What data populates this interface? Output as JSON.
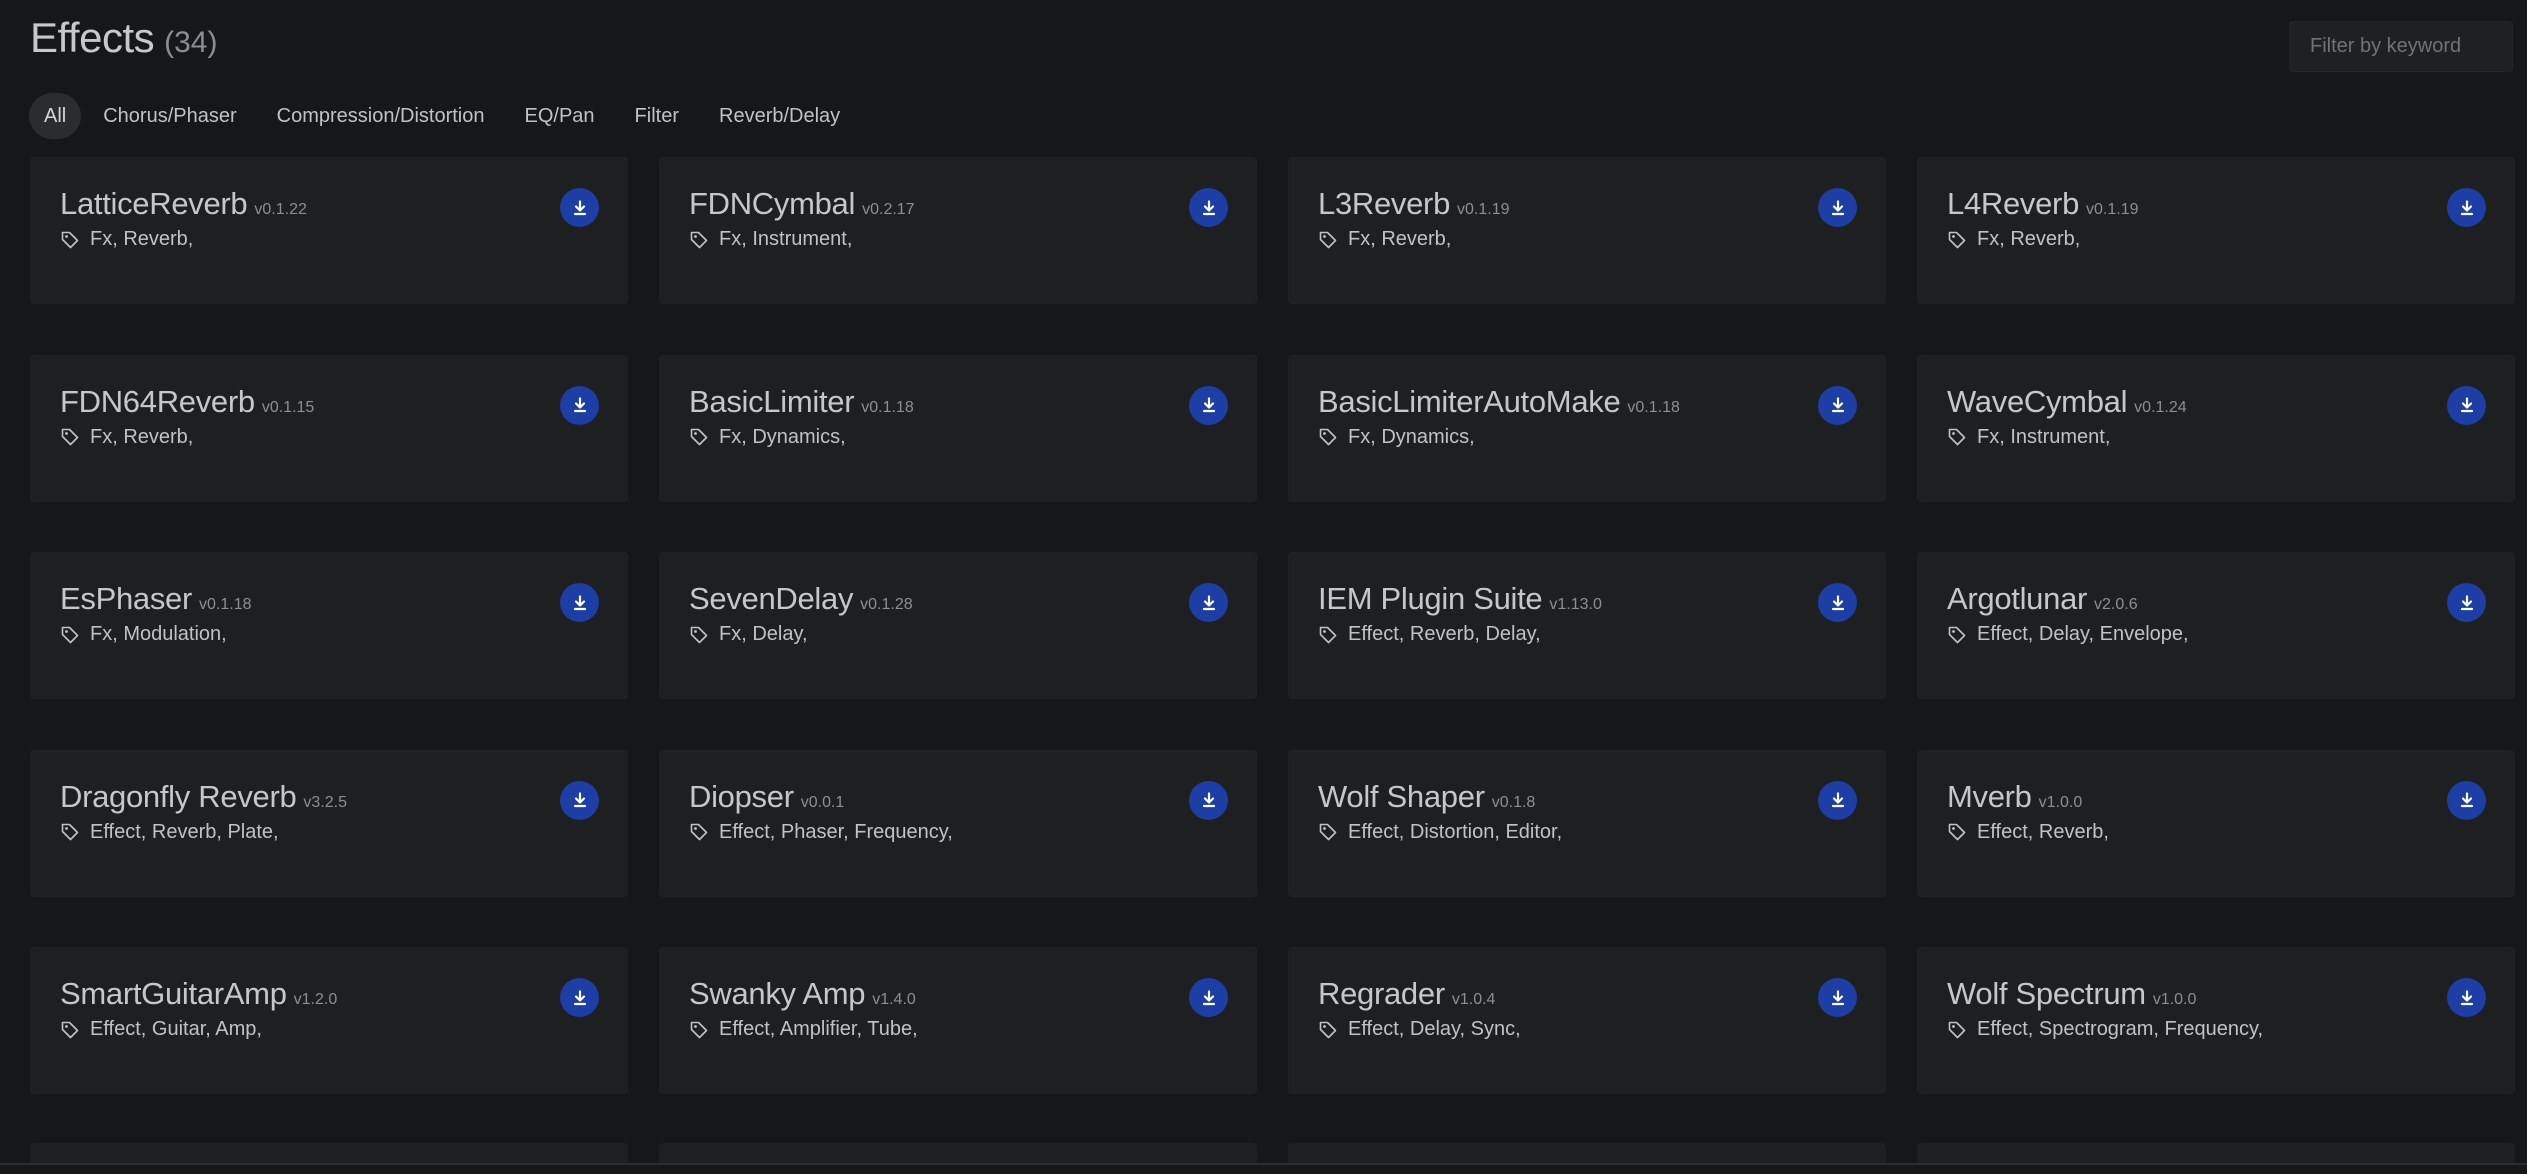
{
  "header": {
    "title": "Effects",
    "count": "(34)"
  },
  "search": {
    "placeholder": "Filter by keyword"
  },
  "tabs": [
    {
      "label": "All",
      "active": true
    },
    {
      "label": "Chorus/Phaser"
    },
    {
      "label": "Compression/Distortion"
    },
    {
      "label": "EQ/Pan"
    },
    {
      "label": "Filter"
    },
    {
      "label": "Reverb/Delay"
    }
  ],
  "colors": {
    "accent": "#1d3ea4",
    "background": "#161718",
    "card": "#1e1f20"
  },
  "icons": {
    "tag": "tag-icon",
    "download": "download-icon"
  },
  "plugins": [
    {
      "name": "LatticeReverb",
      "version": "v0.1.22",
      "tags": "Fx, Reverb,"
    },
    {
      "name": "FDNCymbal",
      "version": "v0.2.17",
      "tags": "Fx, Instrument,"
    },
    {
      "name": "L3Reverb",
      "version": "v0.1.19",
      "tags": "Fx, Reverb,"
    },
    {
      "name": "L4Reverb",
      "version": "v0.1.19",
      "tags": "Fx, Reverb,"
    },
    {
      "name": "FDN64Reverb",
      "version": "v0.1.15",
      "tags": "Fx, Reverb,"
    },
    {
      "name": "BasicLimiter",
      "version": "v0.1.18",
      "tags": "Fx, Dynamics,"
    },
    {
      "name": "BasicLimiterAutoMake",
      "version": "v0.1.18",
      "tags": "Fx, Dynamics,"
    },
    {
      "name": "WaveCymbal",
      "version": "v0.1.24",
      "tags": "Fx, Instrument,"
    },
    {
      "name": "EsPhaser",
      "version": "v0.1.18",
      "tags": "Fx, Modulation,"
    },
    {
      "name": "SevenDelay",
      "version": "v0.1.28",
      "tags": "Fx, Delay,"
    },
    {
      "name": "IEM Plugin Suite",
      "version": "v1.13.0",
      "tags": "Effect, Reverb, Delay,"
    },
    {
      "name": "Argotlunar",
      "version": "v2.0.6",
      "tags": "Effect, Delay, Envelope,"
    },
    {
      "name": "Dragonfly Reverb",
      "version": "v3.2.5",
      "tags": "Effect, Reverb, Plate,"
    },
    {
      "name": "Diopser",
      "version": "v0.0.1",
      "tags": "Effect, Phaser, Frequency,"
    },
    {
      "name": "Wolf Shaper",
      "version": "v0.1.8",
      "tags": "Effect, Distortion, Editor,"
    },
    {
      "name": "Mverb",
      "version": "v1.0.0",
      "tags": "Effect, Reverb,"
    },
    {
      "name": "SmartGuitarAmp",
      "version": "v1.2.0",
      "tags": "Effect, Guitar, Amp,"
    },
    {
      "name": "Swanky Amp",
      "version": "v1.4.0",
      "tags": "Effect, Amplifier, Tube,"
    },
    {
      "name": "Regrader",
      "version": "v1.0.4",
      "tags": "Effect, Delay, Sync,"
    },
    {
      "name": "Wolf Spectrum",
      "version": "v1.0.0",
      "tags": "Effect, Spectrogram, Frequency,"
    }
  ]
}
